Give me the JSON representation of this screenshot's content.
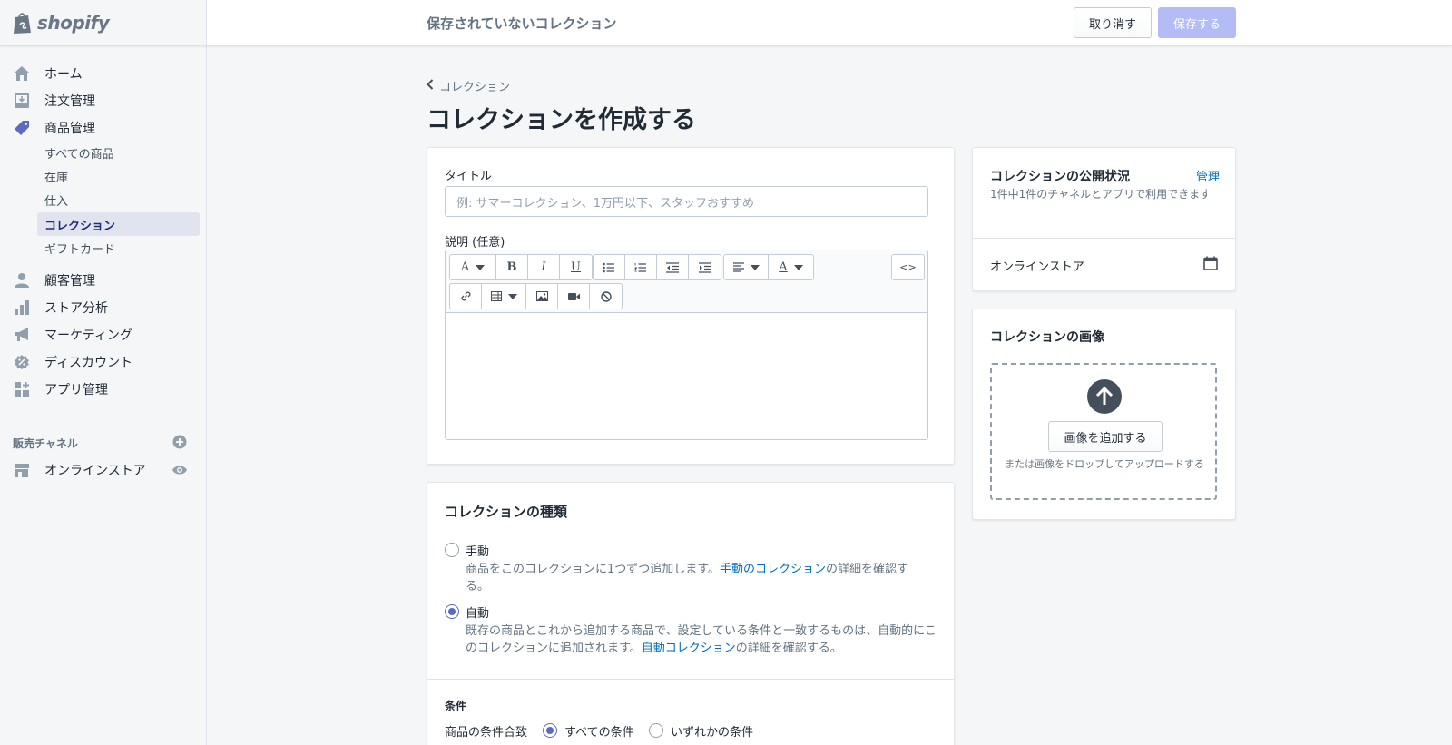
{
  "brand": {
    "name": "shopify"
  },
  "header": {
    "title": "保存されていないコレクション",
    "cancel_label": "取り消す",
    "save_label": "保存する"
  },
  "sidebar": {
    "items": [
      {
        "label": "ホーム",
        "icon": "home-icon"
      },
      {
        "label": "注文管理",
        "icon": "orders-icon"
      },
      {
        "label": "商品管理",
        "icon": "tag-icon"
      },
      {
        "label": "顧客管理",
        "icon": "customer-icon"
      },
      {
        "label": "ストア分析",
        "icon": "analytics-icon"
      },
      {
        "label": "マーケティング",
        "icon": "megaphone-icon"
      },
      {
        "label": "ディスカウント",
        "icon": "discount-icon"
      },
      {
        "label": "アプリ管理",
        "icon": "apps-icon"
      }
    ],
    "product_subitems": [
      "すべての商品",
      "在庫",
      "仕入",
      "コレクション",
      "ギフトカード"
    ],
    "active_subitem": "コレクション",
    "channels_label": "販売チャネル",
    "channel_online_store": "オンラインストア"
  },
  "page": {
    "breadcrumb": "コレクション",
    "title": "コレクションを作成する"
  },
  "form": {
    "title_label": "タイトル",
    "title_placeholder": "例: サマーコレクション、1万円以下、スタッフおすすめ",
    "title_value": "",
    "description_label": "説明 (任意)",
    "toolbar": {
      "font_letter": "A",
      "bold": "B",
      "italic": "I",
      "underline": "U",
      "html_toggle": "<>"
    }
  },
  "collection_type": {
    "heading": "コレクションの種類",
    "manual_label": "手動",
    "manual_help_pre": "商品をこのコレクションに1つずつ追加します。",
    "manual_help_link": "手動のコレクション",
    "manual_help_post": "の詳細を確認する。",
    "auto_label": "自動",
    "auto_help_pre": "既存の商品とこれから追加する商品で、設定している条件と一致するものは、自動的にこのコレクションに追加されます。",
    "auto_help_link": "自動コレクション",
    "auto_help_post": "の詳細を確認する。",
    "selected": "自動"
  },
  "conditions": {
    "heading": "条件",
    "match_label": "商品の条件合致",
    "all_label": "すべての条件",
    "any_label": "いずれかの条件",
    "selected": "すべての条件"
  },
  "availability": {
    "heading": "コレクションの公開状況",
    "manage_label": "管理",
    "summary": "1件中1件のチャネルとアプリで利用できます",
    "channel": "オンラインストア"
  },
  "image_card": {
    "heading": "コレクションの画像",
    "add_button": "画像を追加する",
    "hint": "または画像をドロップしてアップロードする"
  },
  "colors": {
    "accent": "#5c6ac4",
    "link": "#006fbb",
    "active_nav_bg": "#e1e3ee",
    "save_disabled": "#b3bcf5"
  }
}
